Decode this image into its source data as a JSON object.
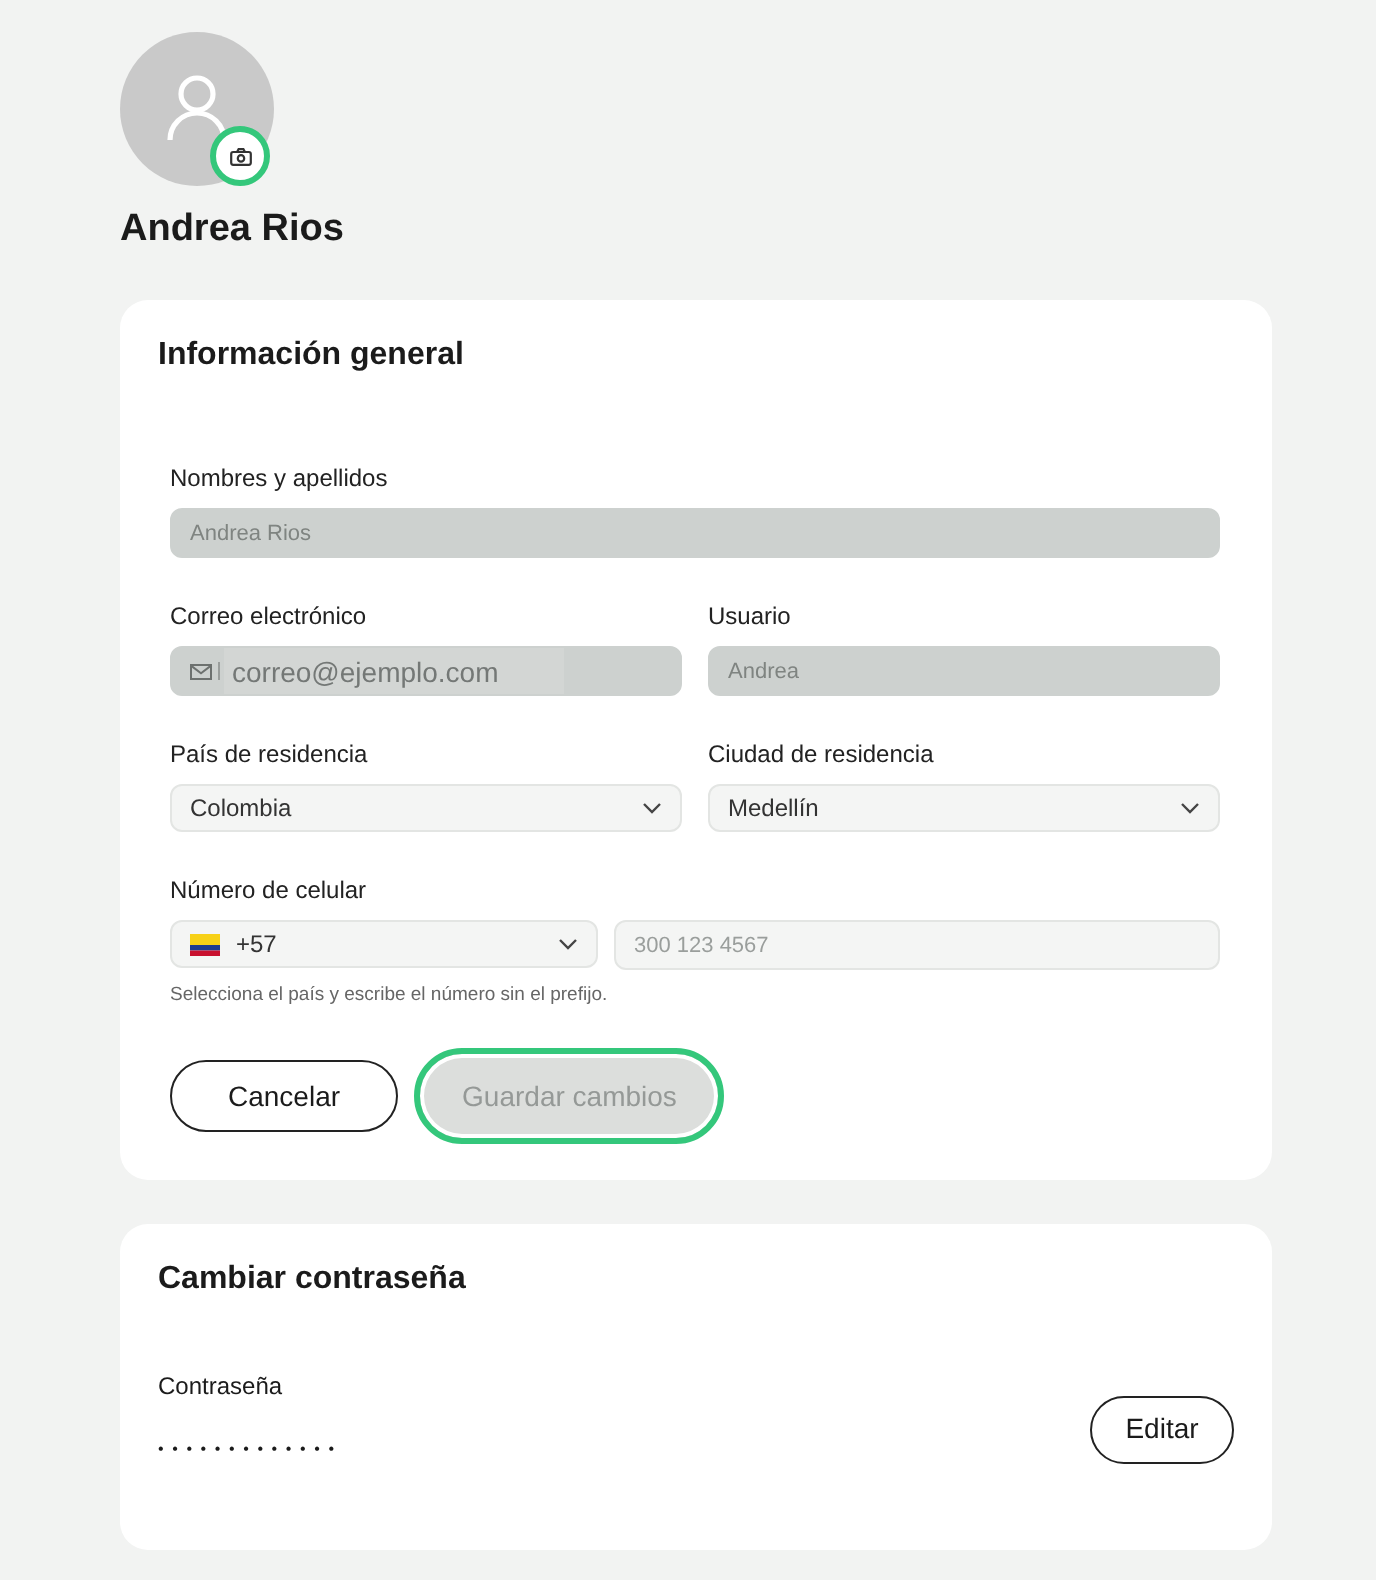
{
  "profile": {
    "name": "Andrea Rios"
  },
  "general_info": {
    "title": "Información general",
    "rows": [
      [
        {
          "kind": "text",
          "label": "Nombres y apellidos",
          "value": "Andrea Rios",
          "disabled": true
        }
      ],
      [
        {
          "kind": "email",
          "label": "Correo electrónico",
          "value": "correo@ejemplo.com",
          "disabled": true
        },
        {
          "kind": "text",
          "label": "Usuario",
          "value": "Andrea",
          "disabled": true
        }
      ],
      [
        {
          "kind": "select",
          "label": "País de residencia",
          "value": "Colombia",
          "disabled": false
        },
        {
          "kind": "select",
          "label": "Ciudad de residencia",
          "value": "Medellín",
          "disabled": false
        }
      ],
      [
        {
          "kind": "phone",
          "label": "Número de celular",
          "code": "+57",
          "placeholder": "300 123 4567",
          "hint": "Selecciona el país y escribe el número sin el prefijo.",
          "disabled": false
        }
      ]
    ],
    "buttons": [
      {
        "label": "Cancelar",
        "kind": "outline",
        "disabled": false,
        "focused": false
      },
      {
        "label": "Guardar cambios",
        "kind": "filled",
        "disabled": true,
        "focused": true
      }
    ]
  },
  "password": {
    "title": "Cambiar contraseña",
    "label": "Contraseña",
    "value": "•••••••••••••",
    "button": "Editar"
  }
}
